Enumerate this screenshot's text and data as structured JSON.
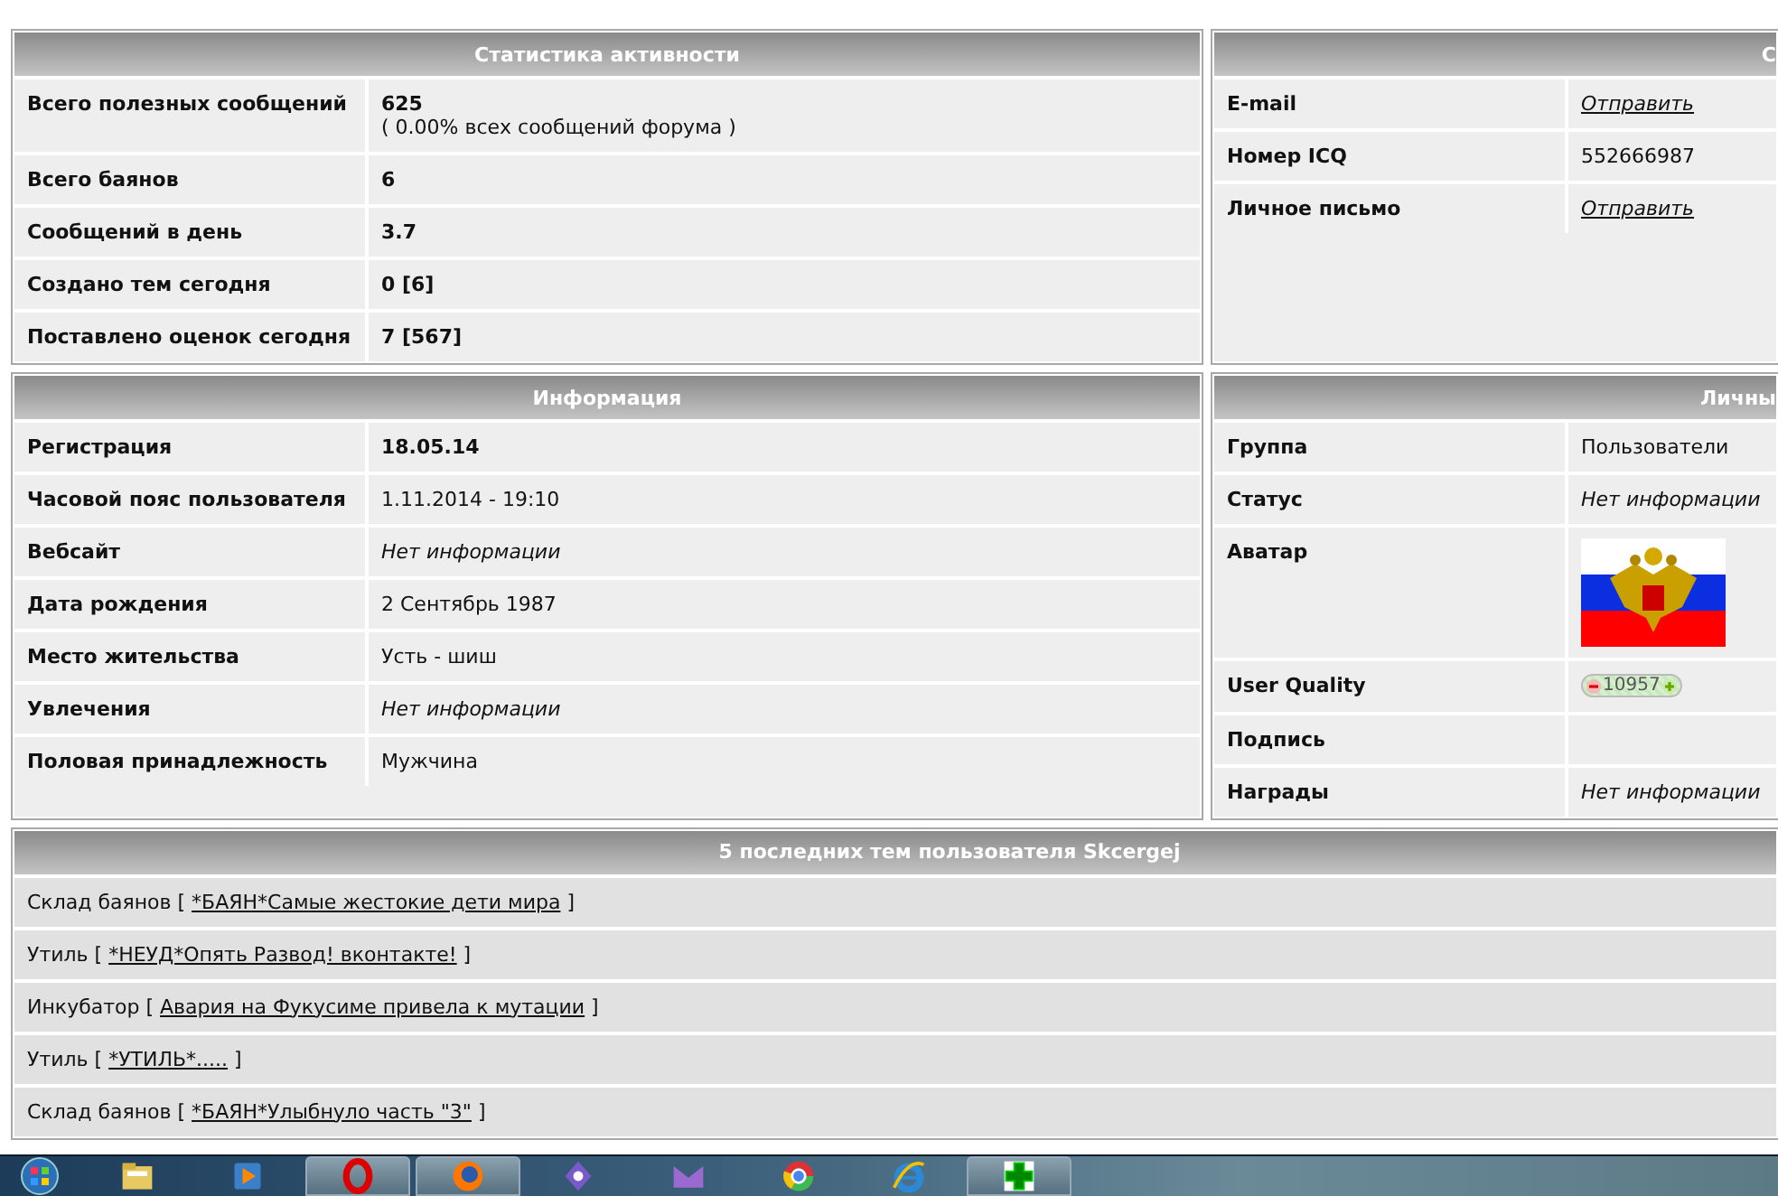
{
  "panels": [
    {
      "title": "Статистика активности",
      "rows": [
        {
          "label": "Всего полезных сообщений",
          "kind": "bold",
          "value": "625",
          "note": "( 0.00% всех сообщений форума )"
        },
        {
          "label": "Всего баянов",
          "kind": "bold",
          "value": "6"
        },
        {
          "label": "Сообщений в день",
          "kind": "bold",
          "value": "3.7"
        },
        {
          "label": "Создано тем сегодня",
          "kind": "bold",
          "value": "0 [6]"
        },
        {
          "label": "Поставлено оценок сегодня",
          "kind": "bold",
          "value": "7 [567]"
        }
      ]
    },
    {
      "title": "С",
      "rows": [
        {
          "label": "E-mail",
          "kind": "link",
          "value": "Отправить"
        },
        {
          "label": "Номер ICQ",
          "kind": "plain",
          "value": "552666987"
        },
        {
          "label": "Личное письмо",
          "kind": "link",
          "value": "Отправить"
        }
      ]
    },
    {
      "title": "Информация",
      "rows": [
        {
          "label": "Регистрация",
          "kind": "bold",
          "value": "18.05.14"
        },
        {
          "label": "Часовой пояс пользователя",
          "kind": "plain",
          "value": "1.11.2014 - 19:10"
        },
        {
          "label": "Вебсайт",
          "kind": "italic",
          "value": "Нет информации"
        },
        {
          "label": "Дата рождения",
          "kind": "plain",
          "value": "2 Сентябрь 1987"
        },
        {
          "label": "Место жительства",
          "kind": "plain",
          "value": "Усть - шиш"
        },
        {
          "label": "Увлечения",
          "kind": "italic",
          "value": "Нет информации"
        },
        {
          "label": "Половая принадлежность",
          "kind": "plain",
          "value": "Мужчина"
        }
      ]
    },
    {
      "title": "Личны",
      "rows": [
        {
          "label": "Группа",
          "kind": "plain",
          "value": "Пользователи"
        },
        {
          "label": "Статус",
          "kind": "italic",
          "value": "Нет информации"
        },
        {
          "label": "Аватар",
          "kind": "picture"
        },
        {
          "label": "User Quality",
          "kind": "rating",
          "value": "10957"
        },
        {
          "label": "Подпись",
          "kind": "empty"
        },
        {
          "label": "Награды",
          "kind": "italic",
          "value": "Нет информации"
        }
      ]
    }
  ],
  "topics": {
    "title": "5 последних тем пользователя Skcergej",
    "items": [
      {
        "forum": "Склад баянов",
        "open": "[",
        "topic": "*БАЯН*Самые жестокие дети мира",
        "close": "]"
      },
      {
        "forum": "Утиль",
        "open": "[",
        "topic": "*НЕУД*Опять Развод! вконтакте!",
        "close": "]"
      },
      {
        "forum": "Инкубатор",
        "open": "[",
        "topic": "Авария на Фукусиме привела к мутации",
        "close": "]"
      },
      {
        "forum": "Утиль",
        "open": "[",
        "topic": "*УТИЛЬ*.....",
        "close": "]"
      },
      {
        "forum": "Склад баянов",
        "open": "[",
        "topic": "*БАЯН*Улыбнуло часть \"3\"",
        "close": "]"
      }
    ]
  },
  "taskbar": {
    "items": [
      {
        "kind": "start"
      },
      {
        "kind": "folder",
        "active": false
      },
      {
        "kind": "media",
        "active": false
      },
      {
        "kind": "opera",
        "active": true
      },
      {
        "kind": "firefox",
        "active": true
      },
      {
        "kind": "diamond",
        "active": false
      },
      {
        "kind": "envelope",
        "active": false
      },
      {
        "kind": "chrome",
        "active": false
      },
      {
        "kind": "ie",
        "active": false
      },
      {
        "kind": "plus",
        "active": true
      }
    ]
  }
}
